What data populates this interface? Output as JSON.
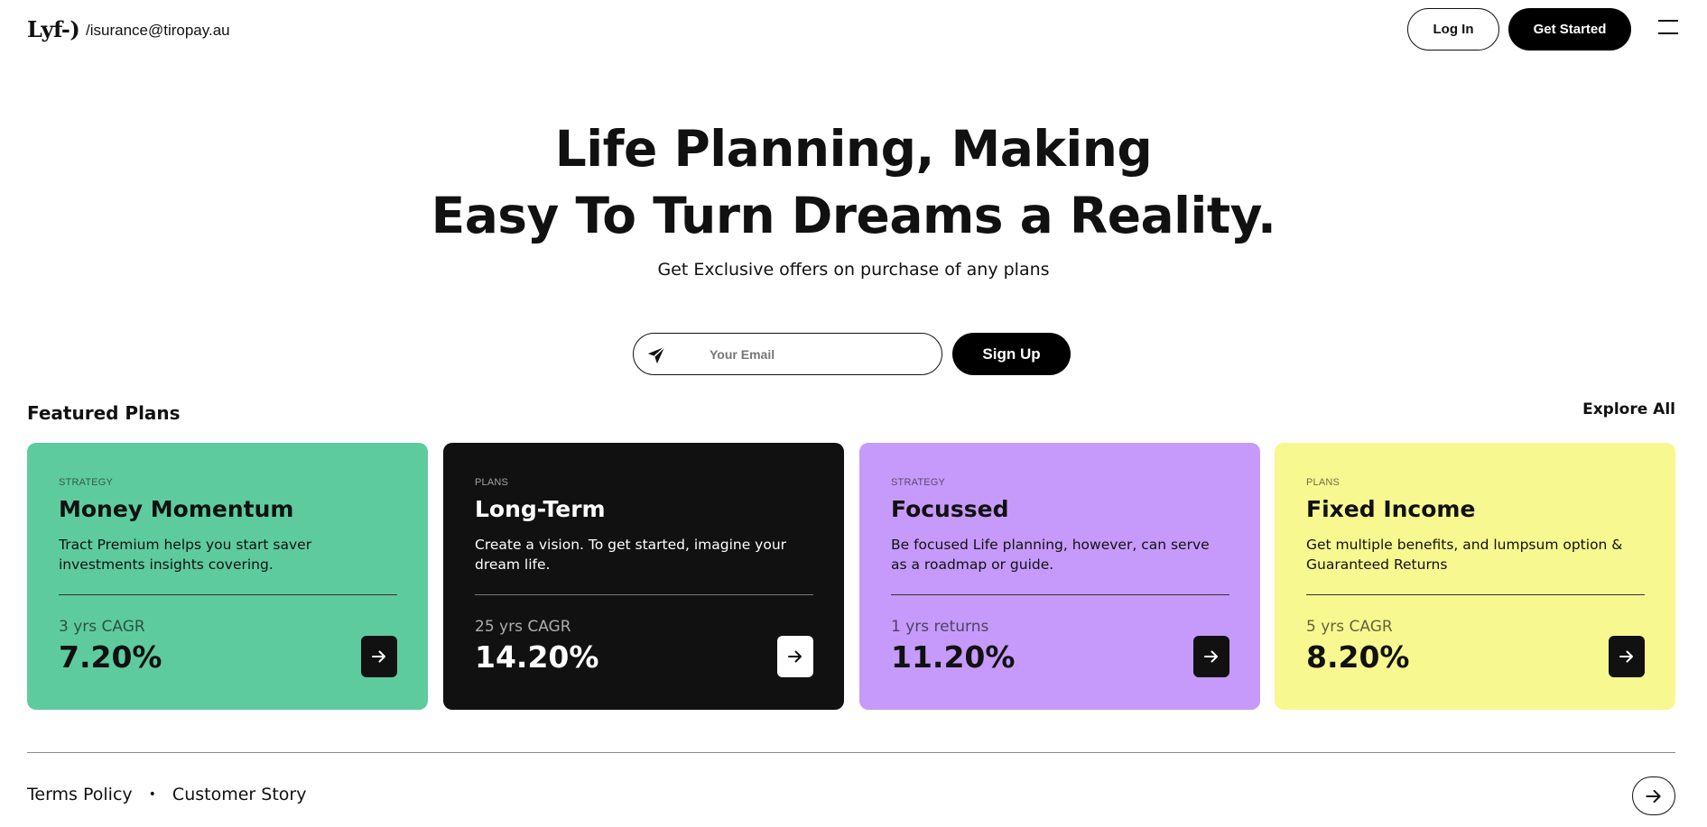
{
  "header": {
    "logo": "Lyf-)",
    "email": "/isurance@tiropay.au",
    "login_label": "Log In",
    "get_started_label": "Get Started"
  },
  "hero": {
    "title_line1": "Life Planning, Making",
    "title_line2": "Easy To Turn Dreams a Reality.",
    "subtitle": "Get Exclusive offers on purchase of any plans"
  },
  "signup": {
    "placeholder": "Your Email",
    "value": "",
    "button_label": "Sign Up"
  },
  "featured": {
    "title": "Featured Plans",
    "explore_label": "Explore All",
    "cards": [
      {
        "tag": "STRATEGY",
        "name": "Money Momentum",
        "description": "Tract Premium helps you start saver investments insights covering.",
        "metric_label": "3 yrs CAGR",
        "metric_value": "7.20%",
        "color": "#5ecb9e"
      },
      {
        "tag": "PLANS",
        "name": "Long-Term",
        "description": "Create a vision. To get started, imagine your dream life.",
        "metric_label": "25 yrs CAGR",
        "metric_value": "14.20%",
        "color": "#111111"
      },
      {
        "tag": "STRATEGY",
        "name": "Focussed",
        "description": "Be focused Life planning, however, can serve as a roadmap or guide.",
        "metric_label": "1 yrs returns",
        "metric_value": "11.20%",
        "color": "#c69afa"
      },
      {
        "tag": "PLANS",
        "name": "Fixed Income",
        "description": "Get multiple benefits, and lumpsum option & Guaranteed Returns",
        "metric_label": "5 yrs CAGR",
        "metric_value": "8.20%",
        "color": "#f8f890"
      }
    ]
  },
  "footer": {
    "terms_label": "Terms Policy",
    "separator": "•",
    "story_label": "Customer Story"
  },
  "icons": {
    "send": "paper-plane-icon",
    "arrow": "arrow-right-icon",
    "menu": "hamburger-menu-icon"
  }
}
